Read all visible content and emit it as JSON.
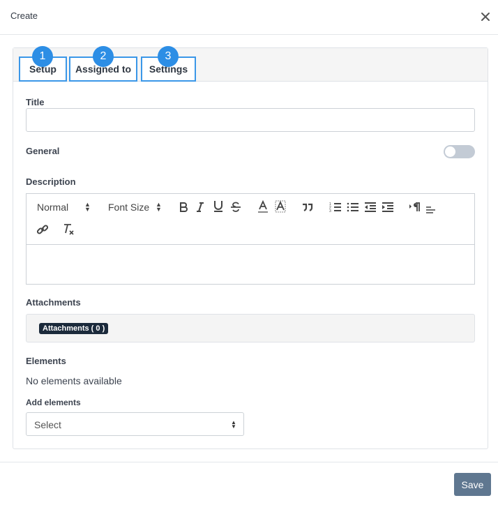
{
  "header": {
    "title": "Create",
    "close_icon": "close-icon"
  },
  "tabs": [
    {
      "number": "1",
      "label": "Setup"
    },
    {
      "number": "2",
      "label": "Assigned to"
    },
    {
      "number": "3",
      "label": "Settings"
    }
  ],
  "form": {
    "title_label": "Title",
    "title_value": "",
    "general_label": "General",
    "general_enabled": false,
    "description_label": "Description",
    "editor": {
      "format_select": "Normal",
      "size_select": "Font Size",
      "tools": [
        "bold-icon",
        "italic-icon",
        "underline-icon",
        "strikethrough-icon",
        "text-color-icon",
        "background-color-icon",
        "blockquote-icon",
        "ordered-list-icon",
        "bullet-list-icon",
        "outdent-icon",
        "indent-icon",
        "text-direction-icon",
        "align-icon",
        "link-icon",
        "clear-format-icon"
      ],
      "content": ""
    },
    "attachments_label": "Attachments",
    "attachments_badge": "Attachments ( 0 )",
    "elements_label": "Elements",
    "elements_empty": "No elements available",
    "add_elements_label": "Add elements",
    "add_elements_select": "Select"
  },
  "footer": {
    "save_label": "Save"
  },
  "colors": {
    "tab_accent": "#3a97e8",
    "badge_blue": "#2d8ee5",
    "save_button": "#5f7790",
    "attachment_badge": "#1b2a3b"
  }
}
